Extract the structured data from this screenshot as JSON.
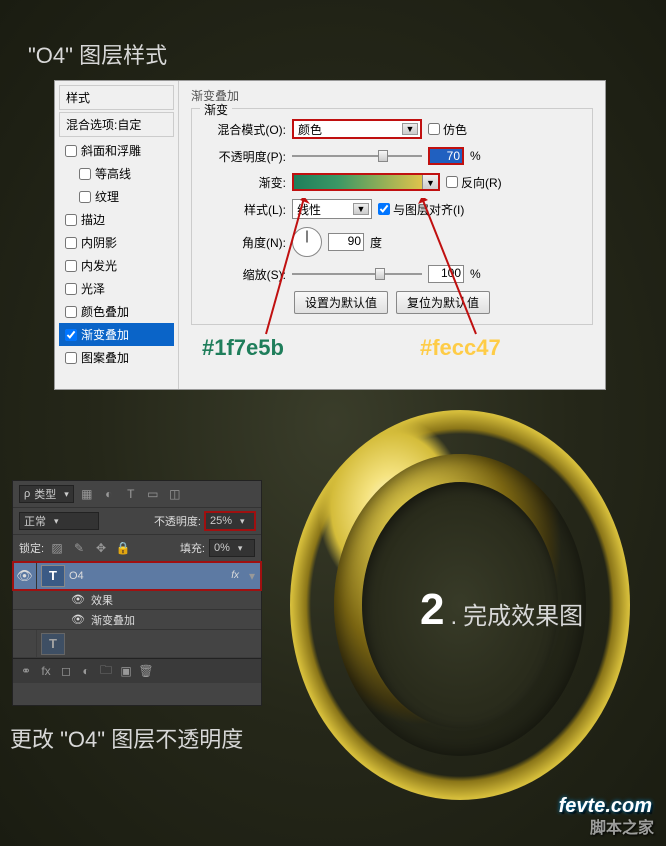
{
  "titles": {
    "main": "\"O4\" 图层样式",
    "opacity": "更改 \"O4\" 图层不透明度"
  },
  "dialog": {
    "sidebar": {
      "header": "样式",
      "blend_opts": "混合选项:自定",
      "items": [
        "斜面和浮雕",
        "等高线",
        "纹理",
        "描边",
        "内阴影",
        "内发光",
        "光泽",
        "颜色叠加",
        "渐变叠加",
        "图案叠加"
      ]
    },
    "section": "渐变叠加",
    "fieldset": "渐变",
    "labels": {
      "blend_mode": "混合模式(O):",
      "opacity": "不透明度(P):",
      "gradient": "渐变:",
      "style": "样式(L):",
      "angle": "角度(N):",
      "scale": "缩放(S):"
    },
    "values": {
      "blend_mode": "颜色",
      "opacity": "70",
      "style": "线性",
      "angle": "90",
      "scale": "100",
      "percent": "%",
      "degree": "度"
    },
    "checks": {
      "dither": "仿色",
      "reverse": "反向(R)",
      "align": "与图层对齐(I)"
    },
    "buttons": {
      "default": "设置为默认值",
      "reset": "复位为默认值"
    }
  },
  "colors": {
    "c1": "#1f7e5b",
    "c2": "#fecc47"
  },
  "layers_panel": {
    "kind_label": "类型",
    "blend": "正常",
    "opacity_label": "不透明度:",
    "opacity_value": "25%",
    "lock_label": "锁定:",
    "fill_label": "填充:",
    "fill_value": "0%",
    "layer_name": "O4",
    "fx": "fx",
    "fx_label": "效果",
    "fx_item": "渐变叠加",
    "layer_t": "T"
  },
  "result": {
    "num": "2",
    "dot": ".",
    "label": "完成效果图"
  },
  "watermark": {
    "w1": "脚本之家",
    "w2": "fevte.com"
  }
}
